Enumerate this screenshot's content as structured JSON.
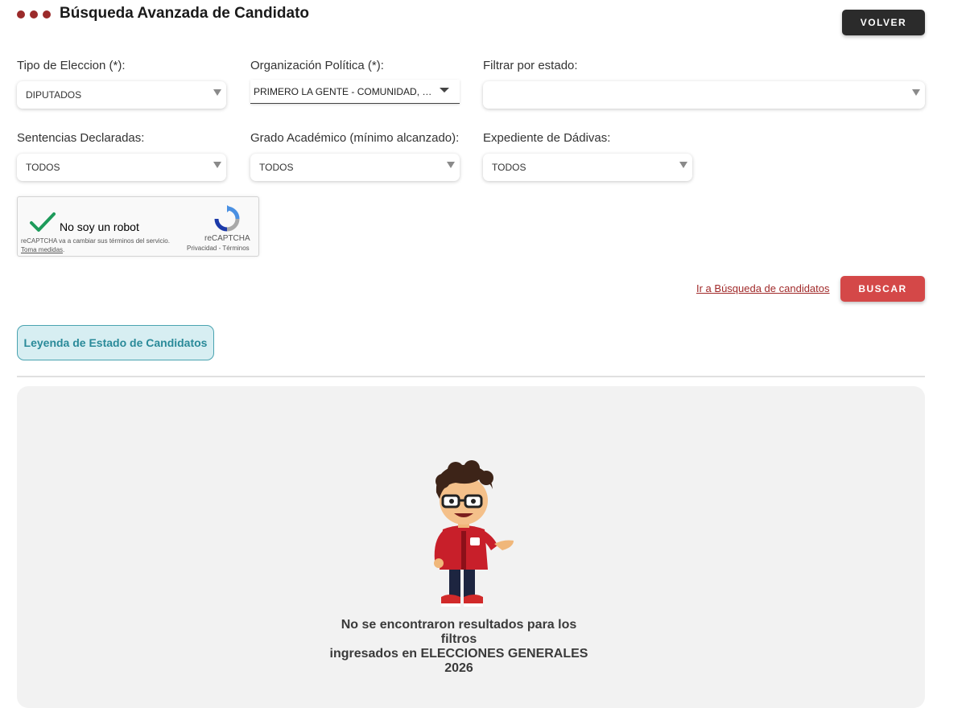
{
  "header": {
    "title": "Búsqueda Avanzada de Candidato",
    "back_label": "VOLVER",
    "accent_color": "#9b2a2a"
  },
  "filters": {
    "tipo_eleccion": {
      "label": "Tipo de Eleccion (*):",
      "value": "DIPUTADOS"
    },
    "organizacion": {
      "label": "Organización Política (*):",
      "value": "PRIMERO LA GENTE - COMUNIDAD, ECOLOGÍA, LIBERTAD Y PROGRESO"
    },
    "estado": {
      "label": "Filtrar por estado:",
      "value": ""
    },
    "sentencias": {
      "label": "Sentencias Declaradas:",
      "value": "TODOS"
    },
    "grado": {
      "label": "Grado Académico (mínimo alcanzado):",
      "value": "TODOS"
    },
    "dadivas": {
      "label": "Expediente de Dádivas:",
      "value": "TODOS"
    }
  },
  "captcha": {
    "label": "No soy un robot",
    "notice": "reCAPTCHA va a cambiar sus términos del servicio.",
    "notice_link": "Toma medidas",
    "brand": "reCAPTCHA",
    "privacy": "Privacidad",
    "separator": "-",
    "terms": "Términos"
  },
  "actions": {
    "link_label": "Ir a Búsqueda de candidatos",
    "search_label": "BUSCAR",
    "search_color": "#d44848"
  },
  "legend": {
    "label": "Leyenda de Estado de Candidatos"
  },
  "results": {
    "line1": "No se encontraron resultados para los filtros",
    "line2": "ingresados en ELECCIONES GENERALES",
    "line3": "2026"
  }
}
